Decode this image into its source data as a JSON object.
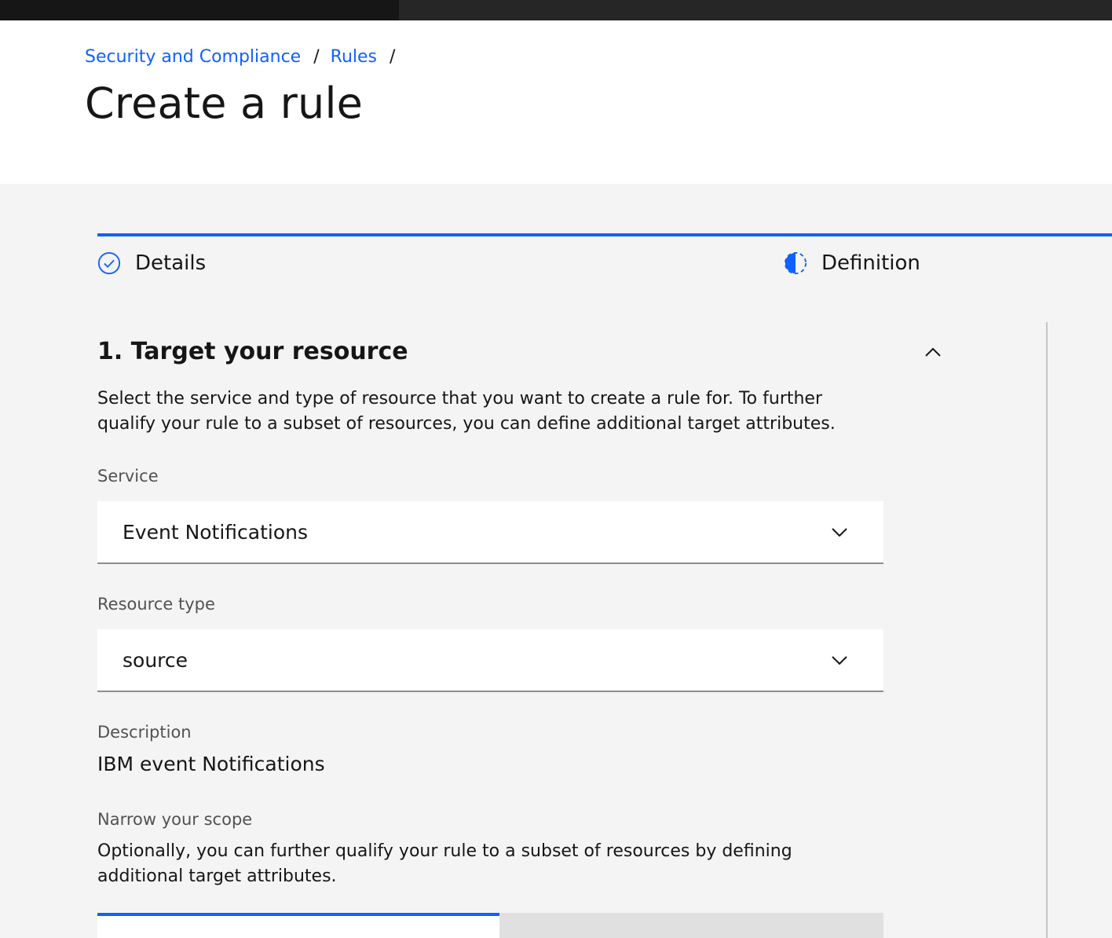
{
  "breadcrumb": {
    "items": [
      {
        "label": "Security and Compliance"
      },
      {
        "label": "Rules"
      }
    ],
    "separator": "/"
  },
  "page": {
    "title": "Create a rule"
  },
  "progress": {
    "steps": [
      {
        "label": "Details",
        "state": "complete",
        "icon": "checkmark-outline-icon"
      },
      {
        "label": "Definition",
        "state": "current",
        "icon": "incomplete-icon"
      }
    ],
    "accent_color": "#0f62fe"
  },
  "section": {
    "title": "1. Target your resource",
    "description": "Select the service and type of resource that you want to create a rule for. To further qualify your rule to a subset of resources, you can define additional target attributes.",
    "collapse_icon": "chevron-up-icon"
  },
  "service": {
    "label": "Service",
    "value": "Event Notifications"
  },
  "resource_type": {
    "label": "Resource type",
    "value": "source"
  },
  "description": {
    "label": "Description",
    "value": "IBM event Notifications"
  },
  "scope": {
    "label": "Narrow your scope",
    "description": "Optionally, you can further qualify your rule to a subset of resources by defining additional target attributes."
  }
}
